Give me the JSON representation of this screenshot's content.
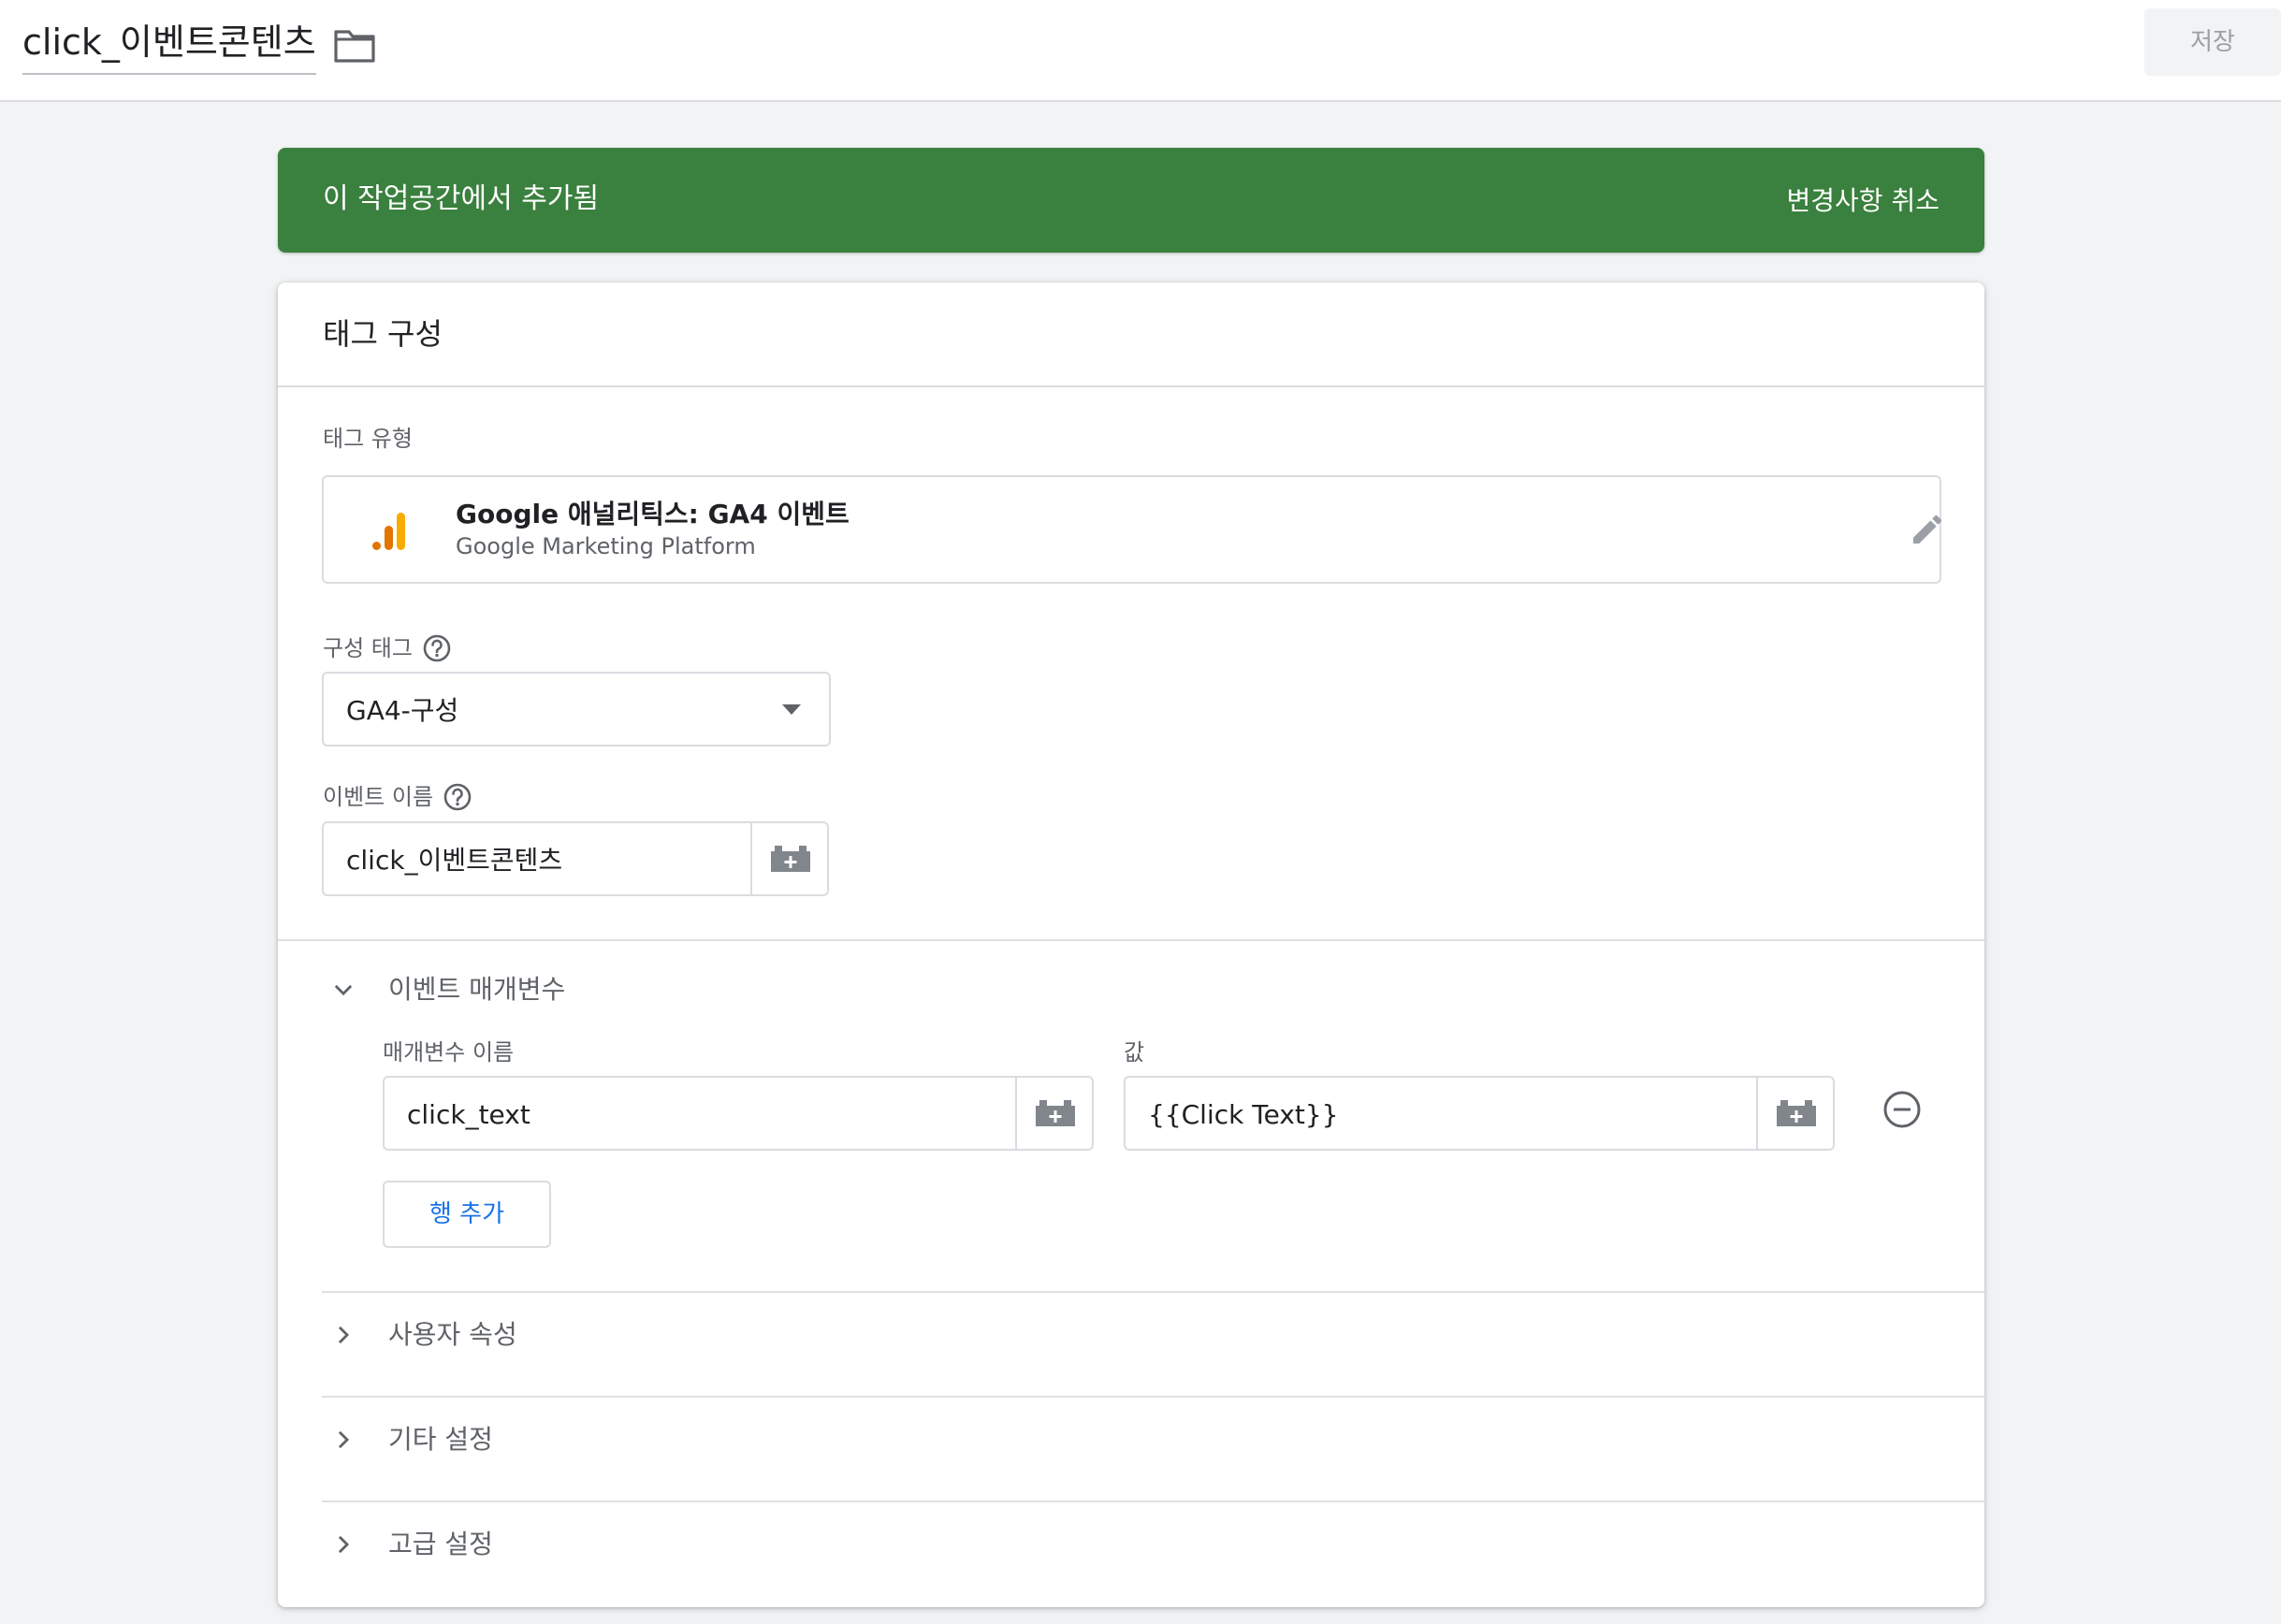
{
  "header": {
    "tag_name": "click_이벤트콘텐츠",
    "save_label": "저장"
  },
  "banner": {
    "message": "이 작업공간에서 추가됨",
    "action": "변경사항 취소",
    "color": "#3a803e"
  },
  "card": {
    "title": "태그 구성",
    "tag_type": {
      "label": "태그 유형",
      "name": "Google 애널리틱스: GA4 이벤트",
      "platform": "Google Marketing Platform",
      "icon": "google-analytics-icon"
    },
    "config_tag": {
      "label": "구성 태그",
      "value": "GA4-구성"
    },
    "event_name": {
      "label": "이벤트 이름",
      "value": "click_이벤트콘텐츠"
    },
    "event_params": {
      "title": "이벤트 매개변수",
      "name_header": "매개변수 이름",
      "value_header": "값",
      "rows": [
        {
          "name": "click_text",
          "value": "{{Click Text}}"
        }
      ],
      "add_row_label": "행 추가"
    },
    "sections": [
      {
        "title": "사용자 속성"
      },
      {
        "title": "기타 설정"
      },
      {
        "title": "고급 설정"
      }
    ]
  },
  "colors": {
    "accent_blue": "#1a73e8",
    "ga_orange": "#e37400",
    "ga_yellow": "#f9ab00"
  }
}
